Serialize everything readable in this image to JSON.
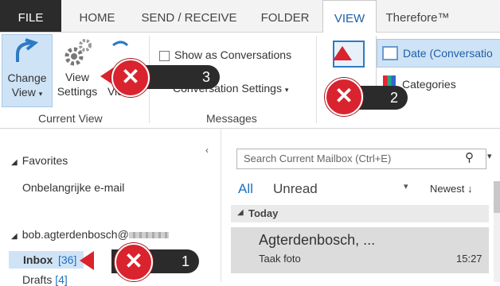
{
  "tabs": [
    {
      "label": "FILE"
    },
    {
      "label": "HOME"
    },
    {
      "label": "SEND / RECEIVE"
    },
    {
      "label": "FOLDER"
    },
    {
      "label": "VIEW"
    },
    {
      "label": "Therefore™"
    }
  ],
  "ribbon": {
    "change_view": {
      "line1": "Change",
      "line2": "View"
    },
    "view_settings": {
      "line1": "View",
      "line2": "Settings"
    },
    "reset_view_partial": "View",
    "current_view_group": "Current View",
    "show_as_conversations": "Show as Conversations",
    "conversation_settings": "Conversation Settings",
    "messages_group": "Messages",
    "arrangement": {
      "date_item": "Date (Conversatio",
      "categories_item": "Categories"
    }
  },
  "nav": {
    "favorites": "Favorites",
    "favorite_folder": "Onbelangrijke e-mail",
    "account": "bob.agterdenbosch@",
    "inbox": {
      "name": "Inbox",
      "count": "[36]"
    },
    "drafts": {
      "name": "Drafts",
      "count": "[4]"
    }
  },
  "mail_list": {
    "search_placeholder": "Search Current Mailbox (Ctrl+E)",
    "filter_all": "All",
    "filter_unread": "Unread",
    "sort_label": "Newest",
    "group_today": "Today",
    "items": [
      {
        "from": "Agterdenbosch, ...",
        "subject": "Taak foto",
        "time": "15:27"
      }
    ]
  },
  "callouts": [
    {
      "number": "1"
    },
    {
      "number": "2"
    },
    {
      "number": "3"
    }
  ],
  "colors": {
    "accent": "#1e5fa8",
    "selection": "#cfe3f6",
    "callout_red": "#d9232e",
    "callout_dark": "#2b2b2b"
  }
}
